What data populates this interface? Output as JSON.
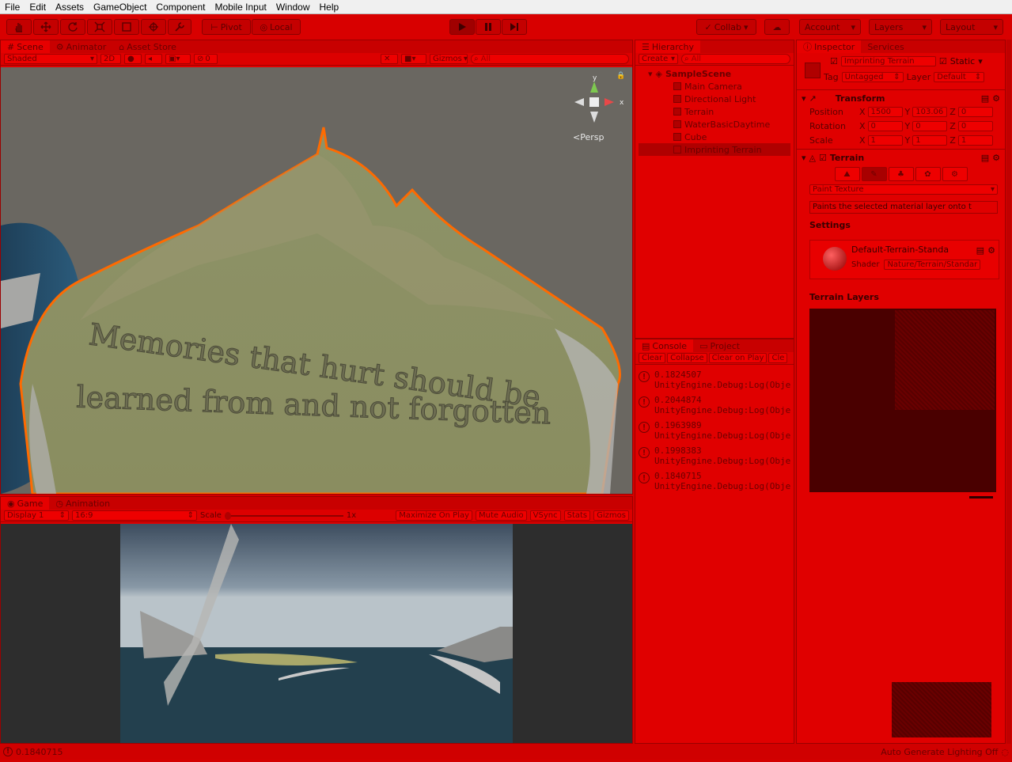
{
  "menu": [
    "File",
    "Edit",
    "Assets",
    "GameObject",
    "Component",
    "Mobile Input",
    "Window",
    "Help"
  ],
  "toolbar": {
    "pivot": "Pivot",
    "local": "Local",
    "collab": "Collab",
    "account": "Account",
    "layers": "Layers",
    "layout": "Layout"
  },
  "scene": {
    "tabs": [
      "Scene",
      "Animator",
      "Asset Store"
    ],
    "shading": "Shaded",
    "mode2d": "2D",
    "hidden_count": "0",
    "gizmos": "Gizmos",
    "search_placeholder": "All",
    "persp": "Persp",
    "gizmo_y": "y",
    "gizmo_x": "x",
    "terrain_text_line1": "Memories that hurt should be",
    "terrain_text_line2": "learned from and not forgotten"
  },
  "hierarchy": {
    "tab": "Hierarchy",
    "create": "Create",
    "search_placeholder": "All",
    "scene_name": "SampleScene",
    "items": [
      "Main Camera",
      "Directional Light",
      "Terrain",
      "WaterBasicDaytime",
      "Cube",
      "Imprinting Terrain"
    ],
    "selected_index": 5
  },
  "console": {
    "tabs": [
      "Console",
      "Project"
    ],
    "buttons": [
      "Clear",
      "Collapse",
      "Clear on Play",
      "Cle"
    ],
    "logs": [
      {
        "value": "0.1824507",
        "source": "UnityEngine.Debug:Log(Objec"
      },
      {
        "value": "0.2044874",
        "source": "UnityEngine.Debug:Log(Objec"
      },
      {
        "value": "0.1963989",
        "source": "UnityEngine.Debug:Log(Objec"
      },
      {
        "value": "0.1998383",
        "source": "UnityEngine.Debug:Log(Objec"
      },
      {
        "value": "0.1840715",
        "source": "UnityEngine.Debug:Log(Objec"
      }
    ]
  },
  "inspector": {
    "tabs": [
      "Inspector",
      "Services"
    ],
    "object_name": "Imprinting Terrain",
    "static": "Static",
    "tag_label": "Tag",
    "tag_value": "Untagged",
    "layer_label": "Layer",
    "layer_value": "Default",
    "transform": {
      "title": "Transform",
      "rows": [
        {
          "label": "Position",
          "x": "1500",
          "y": "103.06",
          "z": "0"
        },
        {
          "label": "Rotation",
          "x": "0",
          "y": "0",
          "z": "0"
        },
        {
          "label": "Scale",
          "x": "1",
          "y": "1",
          "z": "1"
        }
      ]
    },
    "terrain": {
      "title": "Terrain",
      "mode": "Paint Texture",
      "description": "Paints the selected material layer onto t",
      "settings": "Settings",
      "material_name": "Default-Terrain-Standa",
      "shader_label": "Shader",
      "shader_value": "Nature/Terrain/Standar",
      "layers_title": "Terrain Layers"
    }
  },
  "game": {
    "tabs": [
      "Game",
      "Animation"
    ],
    "display": "Display 1",
    "aspect": "16:9",
    "scale_label": "Scale",
    "scale_value": "1x",
    "buttons": [
      "Maximize On Play",
      "Mute Audio",
      "VSync",
      "Stats",
      "Gizmos"
    ]
  },
  "status": {
    "message": "0.1840715",
    "lighting": "Auto Generate Lighting Off"
  }
}
